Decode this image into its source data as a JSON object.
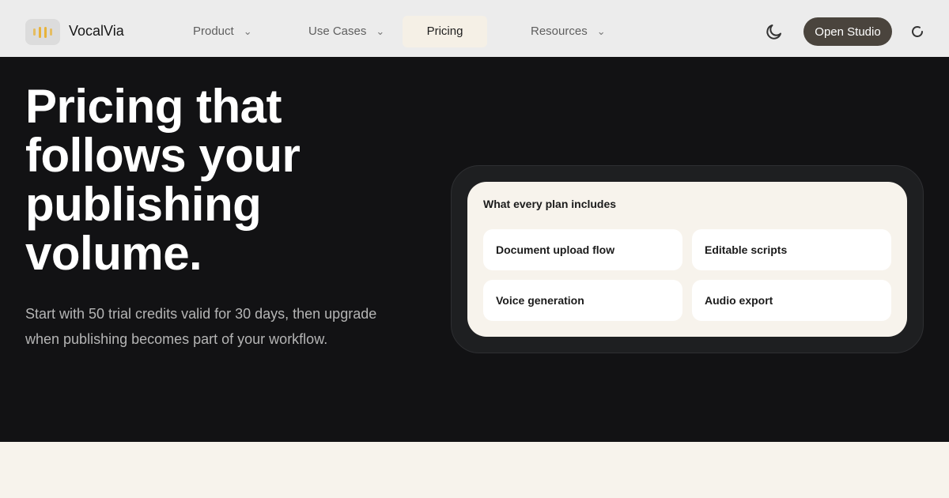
{
  "brand": {
    "name": "VocalVia",
    "logo_icon": "audio-waveform-icon",
    "logo_color": "#e8b33a"
  },
  "nav": {
    "items": [
      {
        "label": "Product",
        "has_dropdown": true
      },
      {
        "label": "Use Cases",
        "has_dropdown": true
      },
      {
        "label": "Pricing",
        "has_dropdown": false,
        "active": true
      },
      {
        "label": "Resources",
        "has_dropdown": true
      }
    ],
    "theme_toggle_icon": "moon-icon",
    "cta_label": "Open Studio",
    "loading_icon": "spinner-icon"
  },
  "hero": {
    "title": "Pricing that follows your publishing volume.",
    "subtitle": "Start with 50 trial credits valid for 30 days, then upgrade when publishing becomes part of your workflow."
  },
  "includes": {
    "heading": "What every plan includes",
    "features": [
      "Document upload flow",
      "Editable scripts",
      "Voice generation",
      "Audio export"
    ]
  },
  "colors": {
    "hero_bg": "#121214",
    "nav_bg": "#ececec",
    "cta_bg": "#4a443d",
    "cream": "#f7f3ec"
  }
}
